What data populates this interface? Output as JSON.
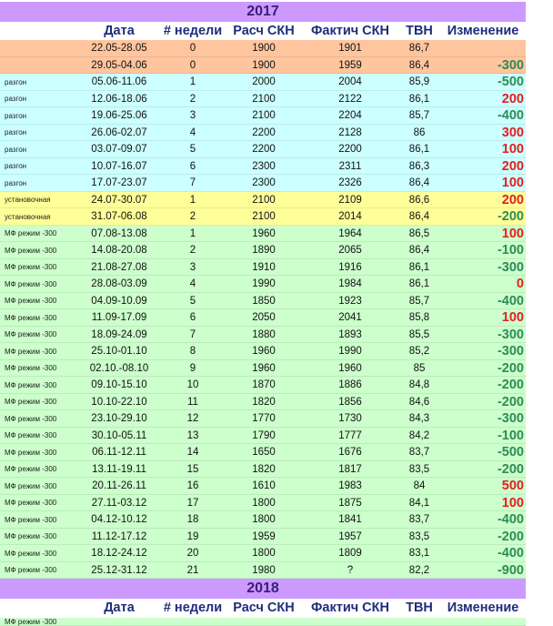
{
  "colors": {
    "orange": "#ffc59e",
    "cyan": "#ccffff",
    "yellow": "#ffff99",
    "green": "#ccffcc",
    "year_bar": "#cc99ff",
    "header_text": "#1f2d7a",
    "positive_change": "#e02020",
    "negative_change": "#2e8b57"
  },
  "year_2017": "2017",
  "year_2018": "2018",
  "headers": {
    "date": "Дата",
    "week": "# недели",
    "calc": "Расч СКН",
    "actual": "Фактич СКН",
    "tvn": "ТВН",
    "change": "Изменение"
  },
  "rows": [
    {
      "phase": "",
      "date": "22.05-28.05",
      "week": "0",
      "calc": "1900",
      "actual": "1901",
      "tvn": "86,7",
      "change": "",
      "color": "orange"
    },
    {
      "phase": "",
      "date": "29.05-04.06",
      "week": "0",
      "calc": "1900",
      "actual": "1959",
      "tvn": "86,4",
      "change": "-300",
      "color": "orange"
    },
    {
      "phase": "разгон",
      "date": "05.06-11.06",
      "week": "1",
      "calc": "2000",
      "actual": "2004",
      "tvn": "85,9",
      "change": "-500",
      "color": "cyan"
    },
    {
      "phase": "разгон",
      "date": "12.06-18.06",
      "week": "2",
      "calc": "2100",
      "actual": "2122",
      "tvn": "86,1",
      "change": "200",
      "color": "cyan"
    },
    {
      "phase": "разгон",
      "date": "19.06-25.06",
      "week": "3",
      "calc": "2100",
      "actual": "2204",
      "tvn": "85,7",
      "change": "-400",
      "color": "cyan"
    },
    {
      "phase": "разгон",
      "date": "26.06-02.07",
      "week": "4",
      "calc": "2200",
      "actual": "2128",
      "tvn": "86",
      "change": "300",
      "color": "cyan"
    },
    {
      "phase": "разгон",
      "date": "03.07-09.07",
      "week": "5",
      "calc": "2200",
      "actual": "2200",
      "tvn": "86,1",
      "change": "100",
      "color": "cyan"
    },
    {
      "phase": "разгон",
      "date": "10.07-16.07",
      "week": "6",
      "calc": "2300",
      "actual": "2311",
      "tvn": "86,3",
      "change": "200",
      "color": "cyan"
    },
    {
      "phase": "разгон",
      "date": "17.07-23.07",
      "week": "7",
      "calc": "2300",
      "actual": "2326",
      "tvn": "86,4",
      "change": "100",
      "color": "cyan"
    },
    {
      "phase": "установочная",
      "date": "24.07-30.07",
      "week": "1",
      "calc": "2100",
      "actual": "2109",
      "tvn": "86,6",
      "change": "200",
      "color": "yellow"
    },
    {
      "phase": "установочная",
      "date": "31.07-06.08",
      "week": "2",
      "calc": "2100",
      "actual": "2014",
      "tvn": "86,4",
      "change": "-200",
      "color": "yellow"
    },
    {
      "phase": "МФ режим -300",
      "date": "07.08-13.08",
      "week": "1",
      "calc": "1960",
      "actual": "1964",
      "tvn": "86,5",
      "change": "100",
      "color": "green"
    },
    {
      "phase": "МФ режим -300",
      "date": "14.08-20.08",
      "week": "2",
      "calc": "1890",
      "actual": "2065",
      "tvn": "86,4",
      "change": "-100",
      "color": "green"
    },
    {
      "phase": "МФ режим -300",
      "date": "21.08-27.08",
      "week": "3",
      "calc": "1910",
      "actual": "1916",
      "tvn": "86,1",
      "change": "-300",
      "color": "green"
    },
    {
      "phase": "МФ режим -300",
      "date": "28.08-03.09",
      "week": "4",
      "calc": "1990",
      "actual": "1984",
      "tvn": "86,1",
      "change": "0",
      "color": "green"
    },
    {
      "phase": "МФ режим -300",
      "date": "04.09-10.09",
      "week": "5",
      "calc": "1850",
      "actual": "1923",
      "tvn": "85,7",
      "change": "-400",
      "color": "green"
    },
    {
      "phase": "МФ режим -300",
      "date": "11.09-17.09",
      "week": "6",
      "calc": "2050",
      "actual": "2041",
      "tvn": "85,8",
      "change": "100",
      "color": "green"
    },
    {
      "phase": "МФ режим -300",
      "date": "18.09-24.09",
      "week": "7",
      "calc": "1880",
      "actual": "1893",
      "tvn": "85,5",
      "change": "-300",
      "color": "green"
    },
    {
      "phase": "МФ режим -300",
      "date": "25.10-01.10",
      "week": "8",
      "calc": "1960",
      "actual": "1990",
      "tvn": "85,2",
      "change": "-300",
      "color": "green"
    },
    {
      "phase": "МФ режим -300",
      "date": "02.10.-08.10",
      "week": "9",
      "calc": "1960",
      "actual": "1960",
      "tvn": "85",
      "change": "-200",
      "color": "green"
    },
    {
      "phase": "МФ режим -300",
      "date": "09.10-15.10",
      "week": "10",
      "calc": "1870",
      "actual": "1886",
      "tvn": "84,8",
      "change": "-200",
      "color": "green"
    },
    {
      "phase": "МФ режим -300",
      "date": "10.10-22.10",
      "week": "11",
      "calc": "1820",
      "actual": "1856",
      "tvn": "84,6",
      "change": "-200",
      "color": "green"
    },
    {
      "phase": "МФ режим -300",
      "date": "23.10-29.10",
      "week": "12",
      "calc": "1770",
      "actual": "1730",
      "tvn": "84,3",
      "change": "-300",
      "color": "green"
    },
    {
      "phase": "МФ режим -300",
      "date": "30.10-05.11",
      "week": "13",
      "calc": "1790",
      "actual": "1777",
      "tvn": "84,2",
      "change": "-100",
      "color": "green"
    },
    {
      "phase": "МФ режим -300",
      "date": "06.11-12.11",
      "week": "14",
      "calc": "1650",
      "actual": "1676",
      "tvn": "83,7",
      "change": "-500",
      "color": "green"
    },
    {
      "phase": "МФ режим -300",
      "date": "13.11-19.11",
      "week": "15",
      "calc": "1820",
      "actual": "1817",
      "tvn": "83,5",
      "change": "-200",
      "color": "green"
    },
    {
      "phase": "МФ режим -300",
      "date": "20.11-26.11",
      "week": "16",
      "calc": "1610",
      "actual": "1983",
      "tvn": "84",
      "change": "500",
      "color": "green"
    },
    {
      "phase": "МФ режим -300",
      "date": "27.11-03.12",
      "week": "17",
      "calc": "1800",
      "actual": "1875",
      "tvn": "84,1",
      "change": "100",
      "color": "green"
    },
    {
      "phase": "МФ режим -300",
      "date": "04.12-10.12",
      "week": "18",
      "calc": "1800",
      "actual": "1841",
      "tvn": "83,7",
      "change": "-400",
      "color": "green"
    },
    {
      "phase": "МФ режим -300",
      "date": "11.12-17.12",
      "week": "19",
      "calc": "1959",
      "actual": "1957",
      "tvn": "83,5",
      "change": "-200",
      "color": "green"
    },
    {
      "phase": "МФ режим -300",
      "date": "18.12-24.12",
      "week": "20",
      "calc": "1800",
      "actual": "1809",
      "tvn": "83,1",
      "change": "-400",
      "color": "green"
    },
    {
      "phase": "МФ режим -300",
      "date": "25.12-31.12",
      "week": "21",
      "calc": "1980",
      "actual": "?",
      "tvn": "82,2",
      "change": "-900",
      "color": "green"
    }
  ],
  "last_row_phase": "МФ режим -300"
}
